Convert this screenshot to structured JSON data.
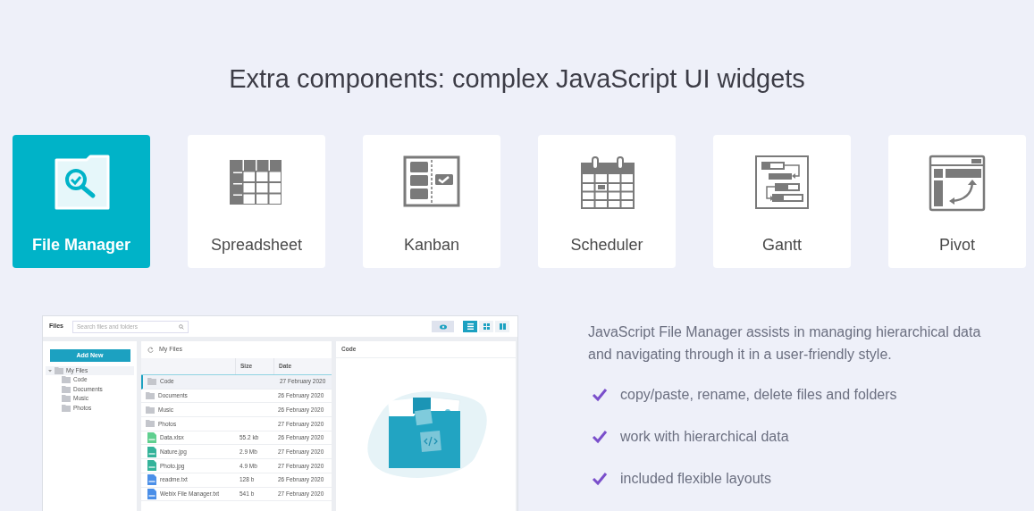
{
  "heading": "Extra components: complex JavaScript UI widgets",
  "cards": [
    {
      "label": "File Manager",
      "selected": true
    },
    {
      "label": "Spreadsheet",
      "selected": false
    },
    {
      "label": "Kanban",
      "selected": false
    },
    {
      "label": "Scheduler",
      "selected": false
    },
    {
      "label": "Gantt",
      "selected": false
    },
    {
      "label": "Pivot",
      "selected": false
    }
  ],
  "demo": {
    "toolbar": {
      "title": "Files",
      "search_placeholder": "Search files and folders",
      "preview_on": true,
      "views": [
        {
          "kind": "list",
          "selected": true
        },
        {
          "kind": "cards",
          "selected": false
        },
        {
          "kind": "columns",
          "selected": false
        }
      ]
    },
    "add_button": "Add New",
    "tree": [
      {
        "label": "My Files",
        "expanded": true,
        "selected": true,
        "children": [
          {
            "label": "Code"
          },
          {
            "label": "Documents"
          },
          {
            "label": "Music"
          },
          {
            "label": "Photos"
          }
        ]
      }
    ],
    "path": "My Files",
    "columns": [
      "Size",
      "Date"
    ],
    "rows": [
      {
        "kind": "folder",
        "name": "Code",
        "size": "",
        "date": "27 February 2020",
        "selected": true
      },
      {
        "kind": "folder",
        "name": "Documents",
        "size": "",
        "date": "26 February 2020",
        "selected": false
      },
      {
        "kind": "folder",
        "name": "Music",
        "size": "",
        "date": "26 February 2020",
        "selected": false
      },
      {
        "kind": "folder",
        "name": "Photos",
        "size": "",
        "date": "27 February 2020",
        "selected": false
      },
      {
        "kind": "sheet",
        "name": "Data.xlsx",
        "size": "55.2 kb",
        "date": "26 February 2020",
        "selected": false
      },
      {
        "kind": "image",
        "name": "Nature.jpg",
        "size": "2.9 Mb",
        "date": "27 February 2020",
        "selected": false
      },
      {
        "kind": "image",
        "name": "Photo.jpg",
        "size": "4.9 Mb",
        "date": "27 February 2020",
        "selected": false
      },
      {
        "kind": "text",
        "name": "readme.txt",
        "size": "128 b",
        "date": "26 February 2020",
        "selected": false
      },
      {
        "kind": "text",
        "name": "Webix File Manager.txt",
        "size": "541 b",
        "date": "27 February 2020",
        "selected": false
      }
    ],
    "preview_title": "Code"
  },
  "description": "JavaScript File Manager assists in managing hierarchical data and navigating through it in a user-friendly style.",
  "features": [
    "copy/paste, rename, delete files and folders",
    "work with hierarchical data",
    "included flexible layouts"
  ]
}
